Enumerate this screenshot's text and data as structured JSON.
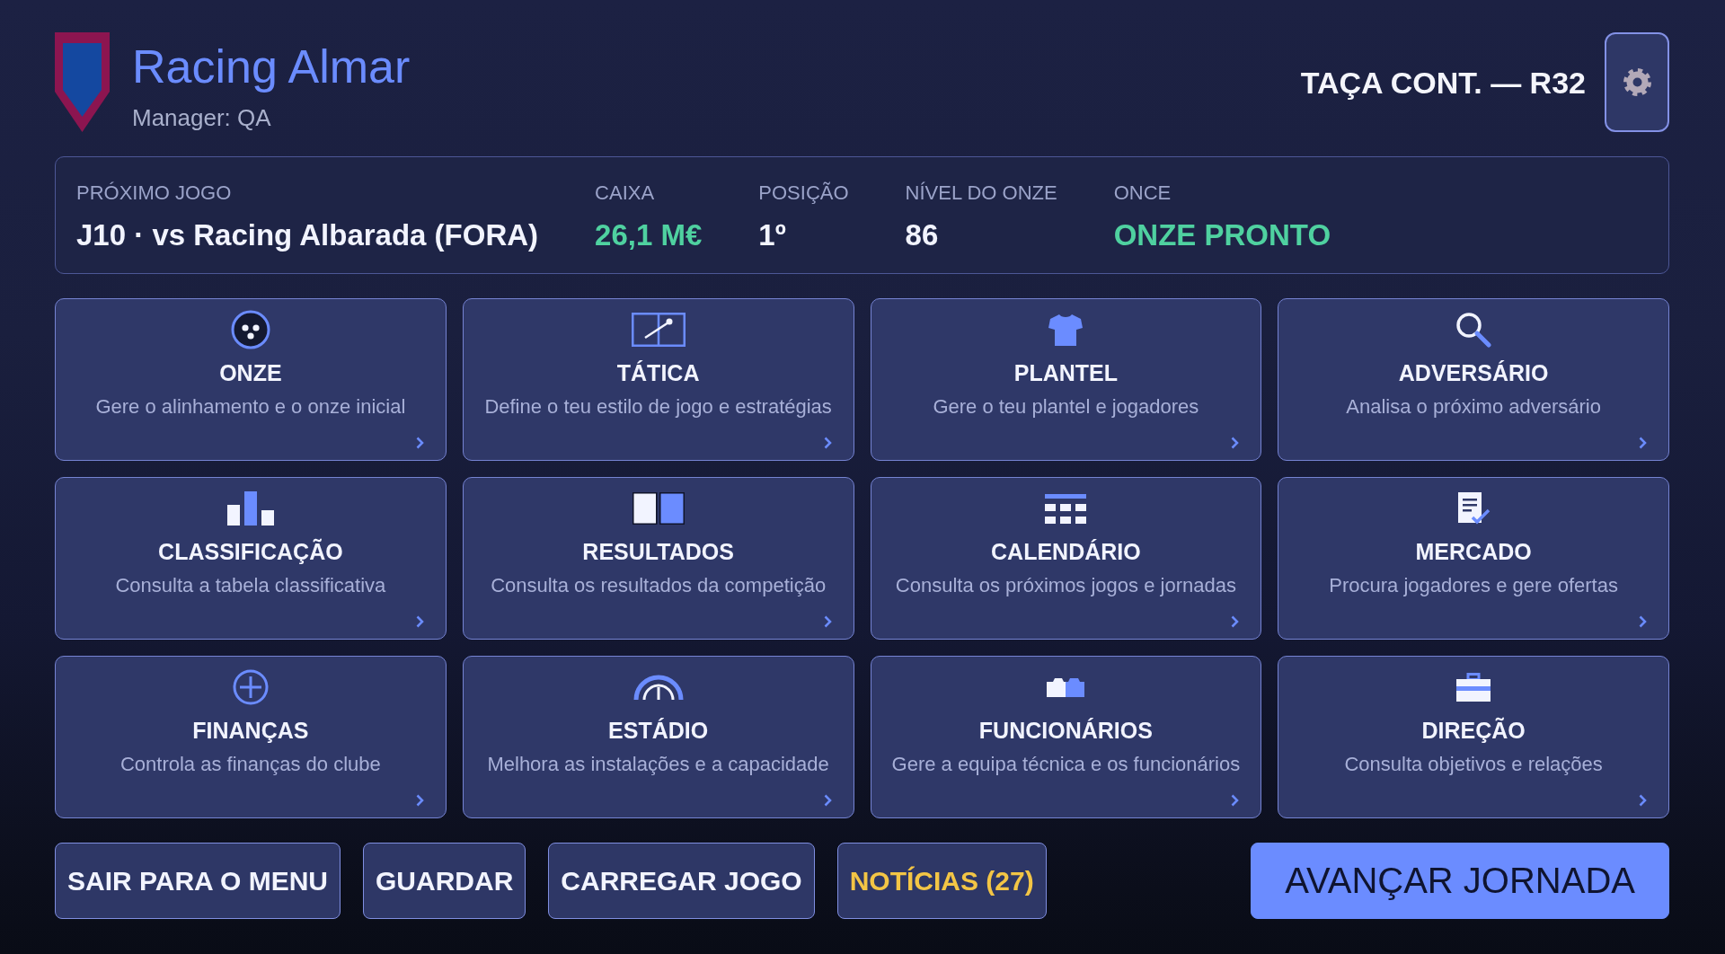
{
  "club": {
    "name": "Racing Almar",
    "manager": "Manager: QA"
  },
  "competition": "TAÇA CONT. — R32",
  "summary": [
    {
      "label": "PRÓXIMO JOGO",
      "value": "J10 · vs Racing Albarada (FORA)",
      "color": "#f2f4ff"
    },
    {
      "label": "CAIXA",
      "value": "26,1 M€",
      "color": "#4fd1a0"
    },
    {
      "label": "POSIÇÃO",
      "value": "1º",
      "color": "#f2f4ff"
    },
    {
      "label": "NÍVEL DO ONZE",
      "value": "86",
      "color": "#f2f4ff"
    },
    {
      "label": "ONCE",
      "value": "ONZE PRONTO",
      "color": "#4fd1a0"
    }
  ],
  "menu": [
    {
      "kind": "lineup",
      "title": "ONZE",
      "description": "Gere o alinhamento e o onze inicial"
    },
    {
      "kind": "tactics",
      "title": "TÁTICA",
      "description": "Define o teu estilo de jogo e estratégias"
    },
    {
      "kind": "squad",
      "title": "PLANTEL",
      "description": "Gere o teu plantel e jogadores"
    },
    {
      "kind": "opponent",
      "title": "ADVERSÁRIO",
      "description": "Analisa o próximo adversário"
    },
    {
      "kind": "standings",
      "title": "CLASSIFICAÇÃO",
      "description": "Consulta a tabela classificativa"
    },
    {
      "kind": "results",
      "title": "RESULTADOS",
      "description": "Consulta os resultados da competição"
    },
    {
      "kind": "calendar",
      "title": "CALENDÁRIO",
      "description": "Consulta os próximos jogos e jornadas"
    },
    {
      "kind": "market",
      "title": "MERCADO",
      "description": "Procura jogadores e gere ofertas"
    },
    {
      "kind": "finances",
      "title": "FINANÇAS",
      "description": "Controla as finanças do clube"
    },
    {
      "kind": "stadium",
      "title": "ESTÁDIO",
      "description": "Melhora as instalações e a capacidade"
    },
    {
      "kind": "staff",
      "title": "FUNCIONÁRIOS",
      "description": "Gere a equipa técnica e os funcionários"
    },
    {
      "kind": "board",
      "title": "DIREÇÃO",
      "description": "Consulta objetivos e relações"
    }
  ],
  "actions": [
    {
      "kind": "exit",
      "label": "SAIR PARA O MENU"
    },
    {
      "kind": "save",
      "label": "GUARDAR"
    },
    {
      "kind": "load",
      "label": "CARREGAR JOGO"
    },
    {
      "kind": "news",
      "label": "NOTÍCIAS (27)"
    },
    {
      "kind": "advance",
      "label": "AVANÇAR JORNADA"
    }
  ]
}
